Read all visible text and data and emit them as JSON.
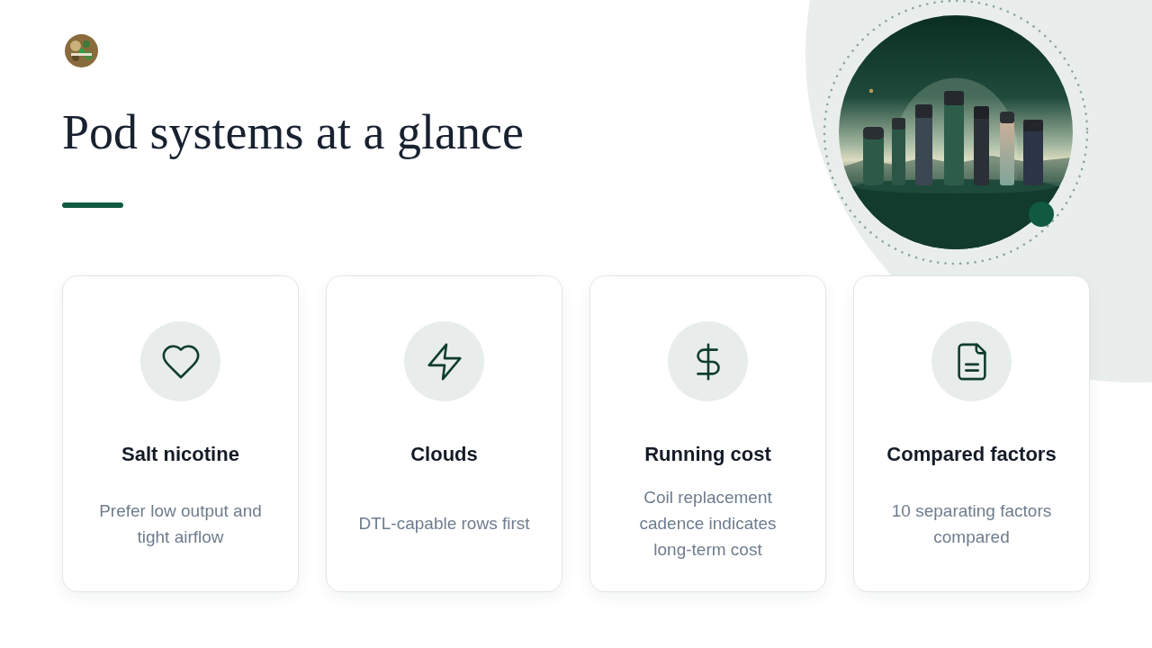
{
  "heading": "Pod systems at a glance",
  "cards": [
    {
      "kind": "heart",
      "title": "Salt nicotine",
      "description": "Prefer low output and tight airflow"
    },
    {
      "kind": "bolt",
      "title": "Clouds",
      "description": "DTL-capable rows first"
    },
    {
      "kind": "dollar",
      "title": "Running cost",
      "description": "Coil replacement cadence indicates long-term cost"
    },
    {
      "kind": "document",
      "title": "Compared factors",
      "description": "10 separating factors compared"
    }
  ]
}
